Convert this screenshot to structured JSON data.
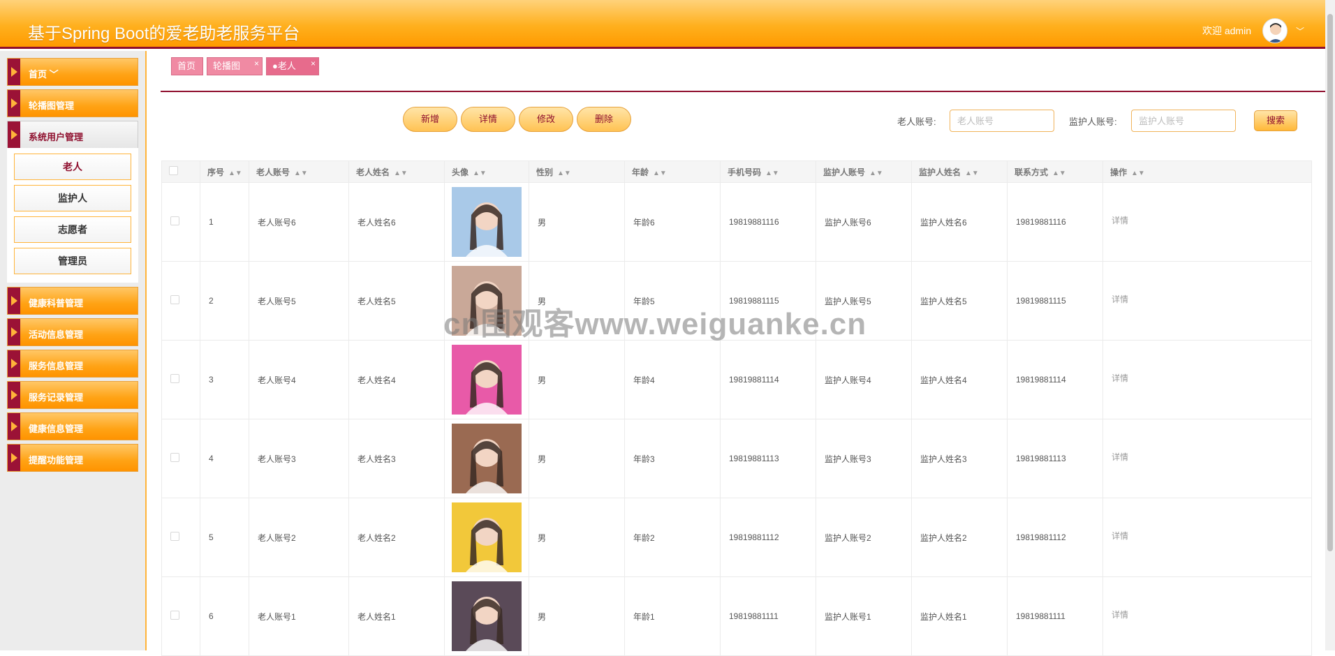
{
  "header": {
    "title": "基于Spring Boot的爱老助老服务平台",
    "welcome": "欢迎 admin",
    "caret": "﹀"
  },
  "sidebar": {
    "items": [
      {
        "label": "首页 ﹀"
      },
      {
        "label": "轮播图管理"
      },
      {
        "label": "系统用户管理"
      },
      {
        "label": "健康科普管理"
      },
      {
        "label": "活动信息管理"
      },
      {
        "label": "服务信息管理"
      },
      {
        "label": "服务记录管理"
      },
      {
        "label": "健康信息管理"
      },
      {
        "label": "提醒功能管理"
      }
    ],
    "submenu": [
      {
        "label": "老人"
      },
      {
        "label": "监护人"
      },
      {
        "label": "志愿者"
      },
      {
        "label": "管理员"
      }
    ]
  },
  "tabs": [
    {
      "label": "首页",
      "close": ""
    },
    {
      "label": "轮播图",
      "close": "×"
    },
    {
      "label": "●老人",
      "close": "×"
    }
  ],
  "toolbar": {
    "add": "新增",
    "detail": "详情",
    "edit": "修改",
    "delete": "删除",
    "search": "搜索"
  },
  "search": {
    "elder_label": "老人账号:",
    "elder_placeholder": "老人账号",
    "guardian_label": "监护人账号:",
    "guardian_placeholder": "监护人账号"
  },
  "table": {
    "columns": [
      "序号",
      "老人账号",
      "老人姓名",
      "头像",
      "性别",
      "年龄",
      "手机号码",
      "监护人账号",
      "监护人姓名",
      "联系方式",
      "操作"
    ],
    "rows": [
      {
        "index": "1",
        "account": "老人账号6",
        "name": "老人姓名6",
        "gender": "男",
        "age": "年龄6",
        "phone": "19819881116",
        "g_account": "监护人账号6",
        "g_name": "监护人姓名6",
        "contact": "19819881116",
        "op": "详情",
        "photo_color": "#a9c9e8"
      },
      {
        "index": "2",
        "account": "老人账号5",
        "name": "老人姓名5",
        "gender": "男",
        "age": "年龄5",
        "phone": "19819881115",
        "g_account": "监护人账号5",
        "g_name": "监护人姓名5",
        "contact": "19819881115",
        "op": "详情",
        "photo_color": "#c9a898"
      },
      {
        "index": "3",
        "account": "老人账号4",
        "name": "老人姓名4",
        "gender": "男",
        "age": "年龄4",
        "phone": "19819881114",
        "g_account": "监护人账号4",
        "g_name": "监护人姓名4",
        "contact": "19819881114",
        "op": "详情",
        "photo_color": "#e85aa8"
      },
      {
        "index": "4",
        "account": "老人账号3",
        "name": "老人姓名3",
        "gender": "男",
        "age": "年龄3",
        "phone": "19819881113",
        "g_account": "监护人账号3",
        "g_name": "监护人姓名3",
        "contact": "19819881113",
        "op": "详情",
        "photo_color": "#9a6a52"
      },
      {
        "index": "5",
        "account": "老人账号2",
        "name": "老人姓名2",
        "gender": "男",
        "age": "年龄2",
        "phone": "19819881112",
        "g_account": "监护人账号2",
        "g_name": "监护人姓名2",
        "contact": "19819881112",
        "op": "详情",
        "photo_color": "#f2c83a"
      },
      {
        "index": "6",
        "account": "老人账号1",
        "name": "老人姓名1",
        "gender": "男",
        "age": "年龄1",
        "phone": "19819881111",
        "g_account": "监护人账号1",
        "g_name": "监护人姓名1",
        "contact": "19819881111",
        "op": "详情",
        "photo_color": "#5a4a58"
      }
    ]
  },
  "watermark": "cn围观客www.weiguanke.cn",
  "colors": {
    "accent": "#ffa315",
    "brand": "#8f0f2e",
    "tab": "#f08aa3"
  }
}
